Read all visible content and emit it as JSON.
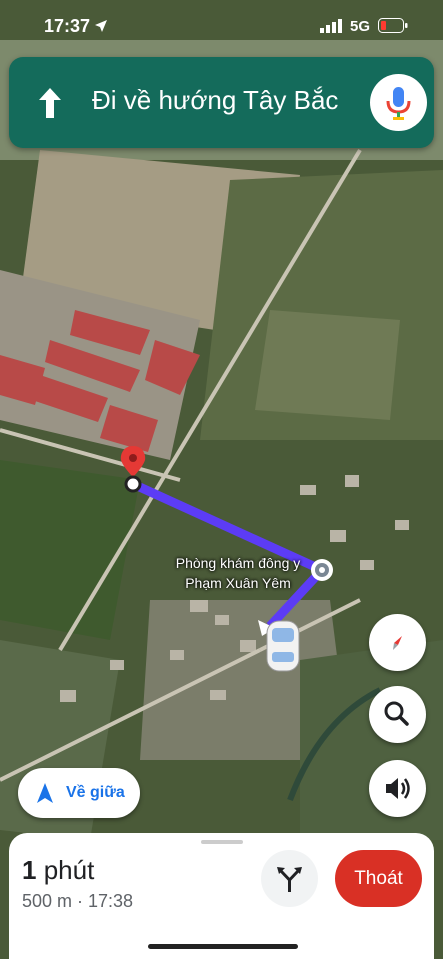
{
  "status_bar": {
    "time": "17:37",
    "network": "5G",
    "battery_color": "#ff3b30"
  },
  "navigation": {
    "instruction": "Đi về hướng Tây Bắc",
    "direction_icon": "arrow-up-icon",
    "mic_icon": "microphone-icon"
  },
  "map": {
    "destination_label": "Phòng khám đông y Phạm Xuân Yêm",
    "route_color": "#5c3cf5"
  },
  "controls": {
    "compass_icon": "compass-icon",
    "search_icon": "search-icon",
    "sound_icon": "speaker-icon",
    "recenter_label": "Về giữa"
  },
  "trip": {
    "duration_value": "1",
    "duration_unit": "phút",
    "distance_arrival": "500 m · 17:38",
    "alt_routes_icon": "route-fork-icon",
    "exit_label": "Thoát",
    "exit_color": "#d93025"
  }
}
